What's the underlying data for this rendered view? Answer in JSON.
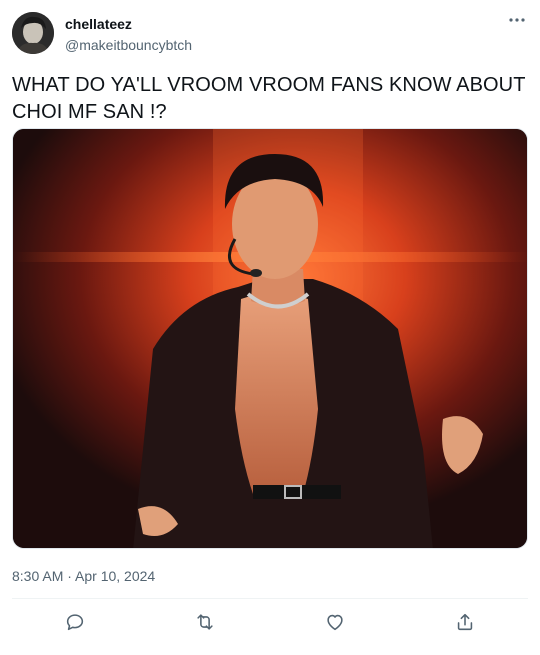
{
  "user": {
    "display_name": "chellateez",
    "handle": "@makeitbouncybtch",
    "avatar_icon": "profile-avatar"
  },
  "tweet": {
    "text": "WHAT DO YA'LL VROOM VROOM FANS KNOW ABOUT CHOI MF SAN !?",
    "timestamp": "8:30 AM · Apr 10, 2024",
    "media_icon": "performer-photo"
  },
  "actions": {
    "reply_icon": "reply-icon",
    "retweet_icon": "retweet-icon",
    "like_icon": "heart-icon",
    "share_icon": "share-icon"
  },
  "colors": {
    "text": "#0f1419",
    "secondary": "#536471",
    "icon": "#536471"
  }
}
